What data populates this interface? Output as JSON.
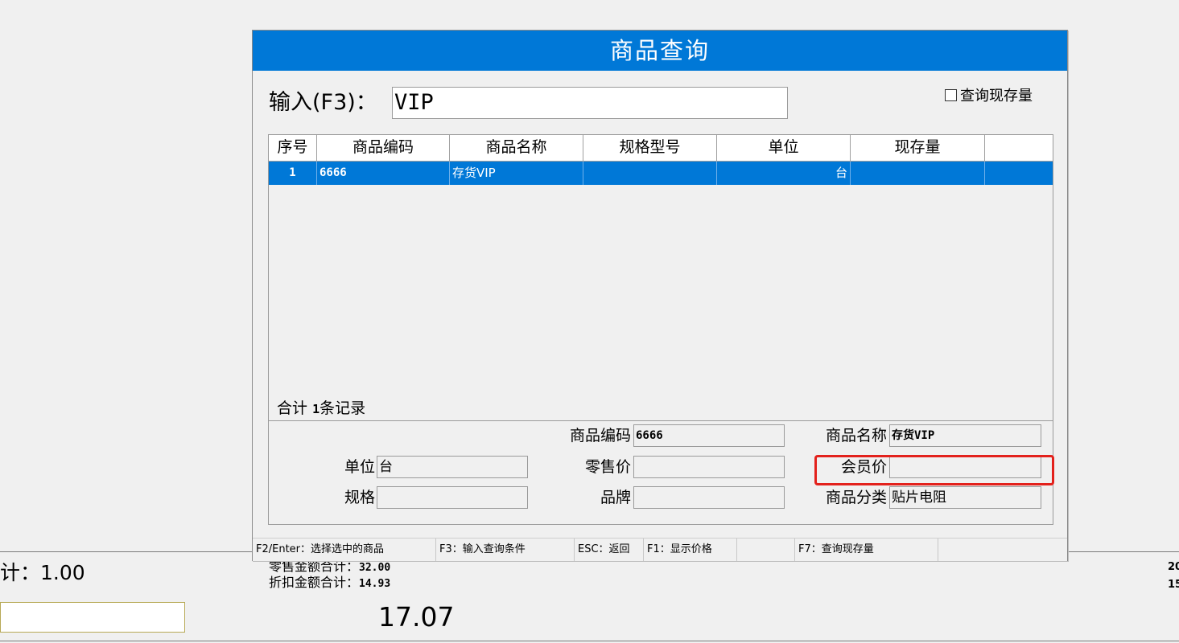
{
  "background": {
    "qty_label": "计：1.00",
    "retail_total_label": "零售金额合计：",
    "retail_total_value": "32.00",
    "discount_total_label": "折扣金额合计：",
    "discount_total_value": "14.93",
    "payable": "17.07",
    "right_edge_top": "20",
    "right_edge_bottom": "15"
  },
  "dialog": {
    "title": "商品查询",
    "input_label": "输入(F3)：",
    "input_value": "VIP",
    "stock_checkbox_label": "查询现存量",
    "stock_checkbox_checked": false
  },
  "grid": {
    "columns": [
      "序号",
      "商品编码",
      "商品名称",
      "规格型号",
      "单位",
      "现存量"
    ],
    "rows": [
      {
        "index": "1",
        "code": "6666",
        "name": "存货VIP",
        "spec": "",
        "unit": "台",
        "stock": ""
      }
    ],
    "footer_prefix": "合计",
    "footer_count": "1",
    "footer_suffix": "条记录"
  },
  "detail": {
    "code_label": "商品编码",
    "code_value": "6666",
    "name_label": "商品名称",
    "name_value": "存货VIP",
    "unit_label": "单位",
    "unit_value": "台",
    "retail_label": "零售价",
    "retail_value": "",
    "member_label": "会员价",
    "member_value": "",
    "spec_label": "规格",
    "spec_value": "",
    "brand_label": "品牌",
    "brand_value": "",
    "category_label": "商品分类",
    "category_value": "贴片电阻"
  },
  "statusbar": [
    "F2/Enter：选择选中的商品",
    "F3：输入查询条件",
    "ESC：返回",
    "F1：显示价格",
    "",
    "F7：查询现存量",
    ""
  ],
  "colors": {
    "accent": "#0078d7",
    "highlight_border": "#e3211c"
  }
}
